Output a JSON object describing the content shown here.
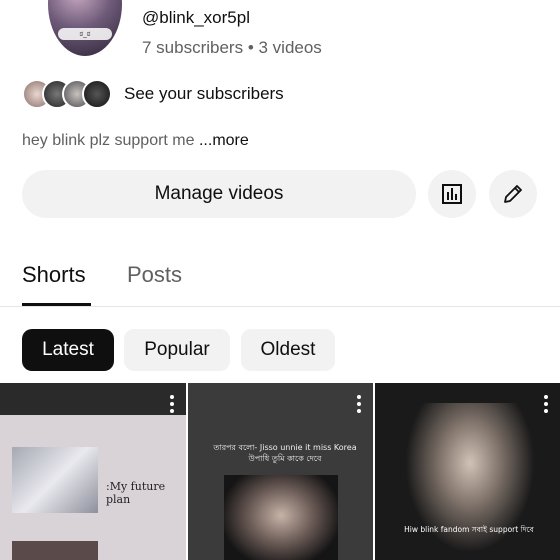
{
  "channel": {
    "handle": "@blink_xor5pl",
    "stats": "7 subscribers • 3 videos",
    "avatar_sticker": "ಠ_ಠ"
  },
  "subscribers_row": {
    "label": "See your subscribers"
  },
  "description": {
    "text": "hey blink plz support me ",
    "more": "...more"
  },
  "actions": {
    "manage_videos": "Manage videos",
    "analytics_icon": "bar-chart-icon",
    "edit_icon": "pencil-icon"
  },
  "tabs": [
    {
      "label": "Shorts",
      "selected": true
    },
    {
      "label": "Posts",
      "selected": false
    }
  ],
  "filters": [
    {
      "label": "Latest",
      "selected": true
    },
    {
      "label": "Popular",
      "selected": false
    },
    {
      "label": "Oldest",
      "selected": false
    }
  ],
  "thumbnails": [
    {
      "text": ":My future plan"
    },
    {
      "text": "তারপর বলো- Jisso unnie it miss Korea উপাধি তুমি কাকে দেবে"
    },
    {
      "text": "Hiw blink fandom সবাই support দিবে"
    }
  ],
  "colors": {
    "chip_selected_bg": "#0f0f0f",
    "chip_bg": "#f2f2f2",
    "secondary_text": "#606060"
  }
}
